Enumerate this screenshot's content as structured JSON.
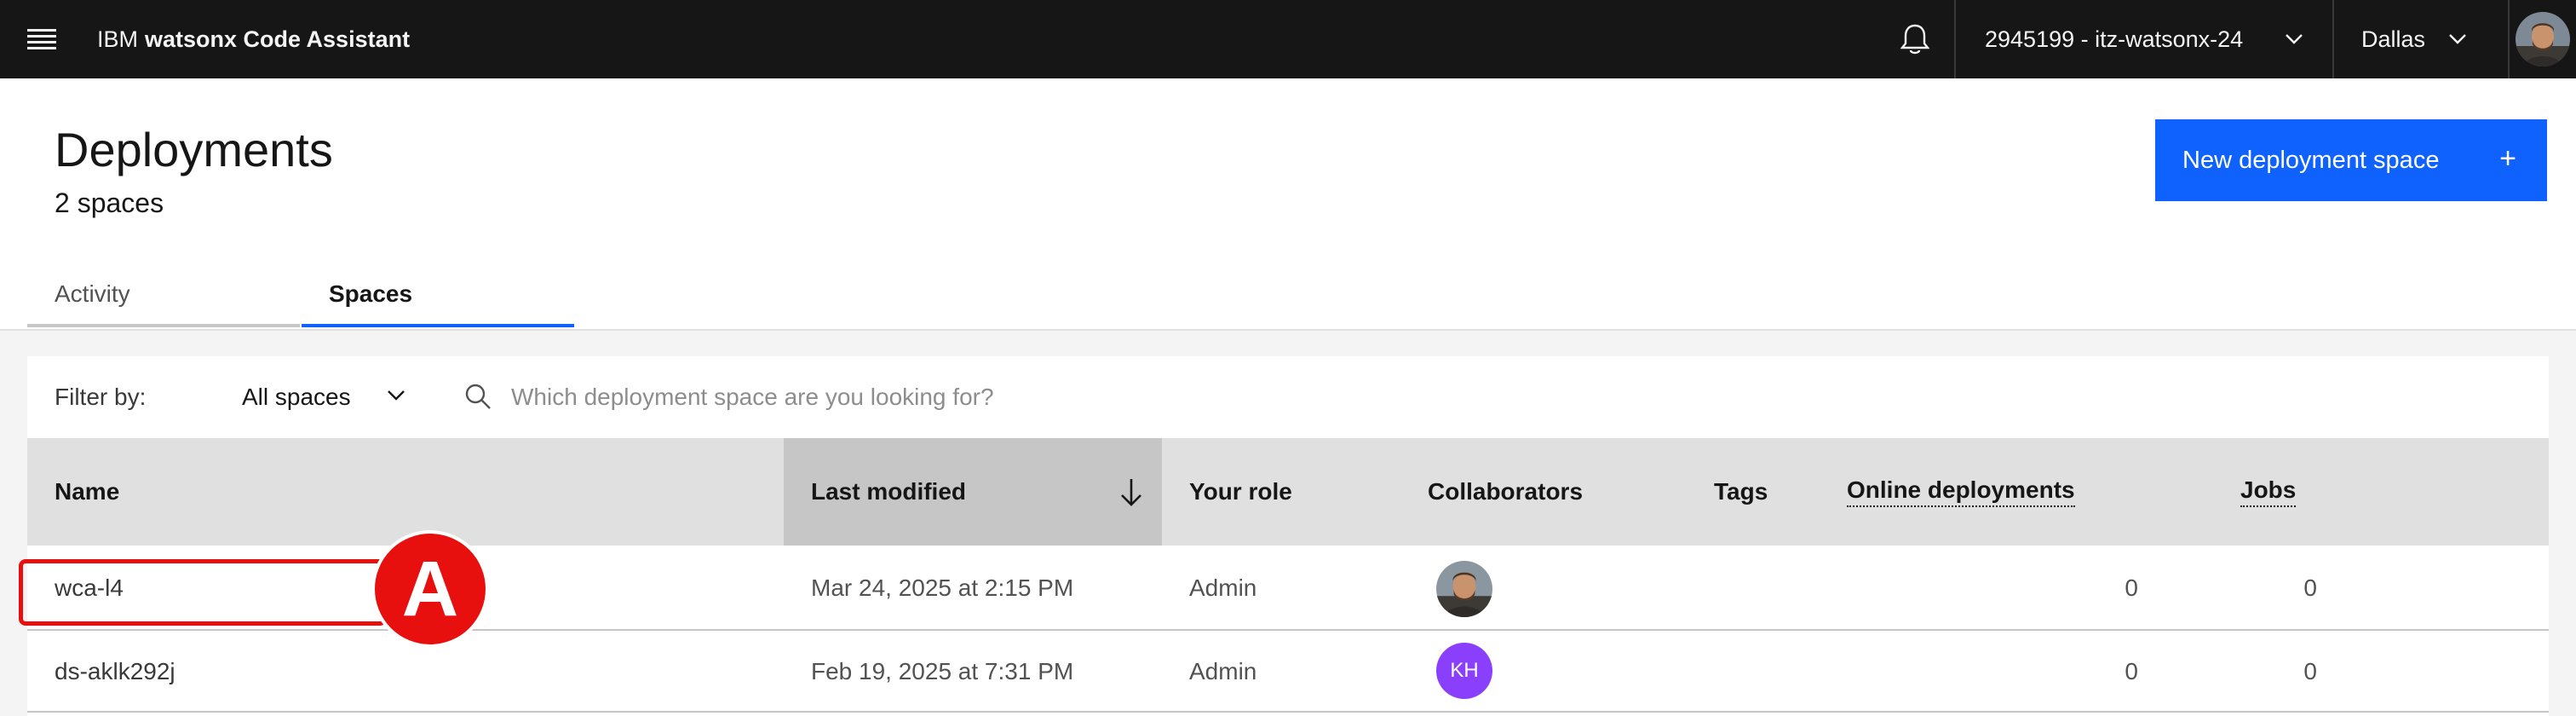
{
  "header": {
    "brand_prefix": "IBM",
    "brand_product": "watsonx Code Assistant",
    "account": "2945199 - itz-watsonx-24",
    "region": "Dallas"
  },
  "page": {
    "title": "Deployments",
    "subtitle": "2 spaces",
    "new_button_label": "New deployment space",
    "new_button_icon": "+"
  },
  "tabs": [
    {
      "label": "Activity",
      "selected": false
    },
    {
      "label": "Spaces",
      "selected": true
    }
  ],
  "filter": {
    "label": "Filter by:",
    "selected": "All spaces",
    "search_placeholder": "Which deployment space are you looking for?",
    "search_value": ""
  },
  "table": {
    "columns": [
      "Name",
      "Last modified",
      "Your role",
      "Collaborators",
      "Tags",
      "Online deployments",
      "Jobs"
    ],
    "sorted_column": "Last modified",
    "sort_direction": "descending",
    "rows": [
      {
        "name": "wca-l4",
        "last_modified": "Mar 24, 2025 at 2:15 PM",
        "role": "Admin",
        "collaborator": "avatar-photo",
        "online_deployments": "0",
        "jobs": "0"
      },
      {
        "name": "ds-aklk292j",
        "last_modified": "Feb 19, 2025 at 7:31 PM",
        "role": "Admin",
        "collaborator_initials": "KH",
        "online_deployments": "0",
        "jobs": "0"
      }
    ]
  },
  "annotation": {
    "badge": "A",
    "color": "#e8100f"
  },
  "colors": {
    "topbar": "#161616",
    "primary": "#0f62fe",
    "table_header": "#e0e0e0",
    "sorted_header": "#c6c6c6",
    "initials_avatar": "#8a3ffc"
  }
}
